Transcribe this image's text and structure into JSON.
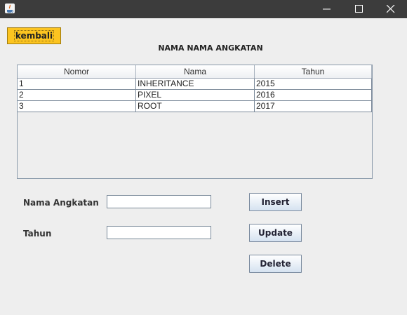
{
  "window": {
    "icon": "java-icon"
  },
  "back_button": {
    "label": "kembali"
  },
  "page_title": "NAMA NAMA ANGKATAN",
  "table": {
    "columns": [
      "Nomor",
      "Nama",
      "Tahun"
    ],
    "rows": [
      [
        "1",
        "INHERITANCE",
        "2015"
      ],
      [
        "2",
        "PIXEL",
        "2016"
      ],
      [
        "3",
        "ROOT",
        "2017"
      ]
    ]
  },
  "form": {
    "nama_angkatan_label": "Nama Angkatan",
    "nama_angkatan_value": "",
    "tahun_label": "Tahun",
    "tahun_value": ""
  },
  "buttons": {
    "insert": "Insert",
    "update": "Update",
    "delete": "Delete"
  },
  "colors": {
    "titlebar": "#3c3c3c",
    "back_button": "#fcc420",
    "background": "#eeeeee"
  }
}
